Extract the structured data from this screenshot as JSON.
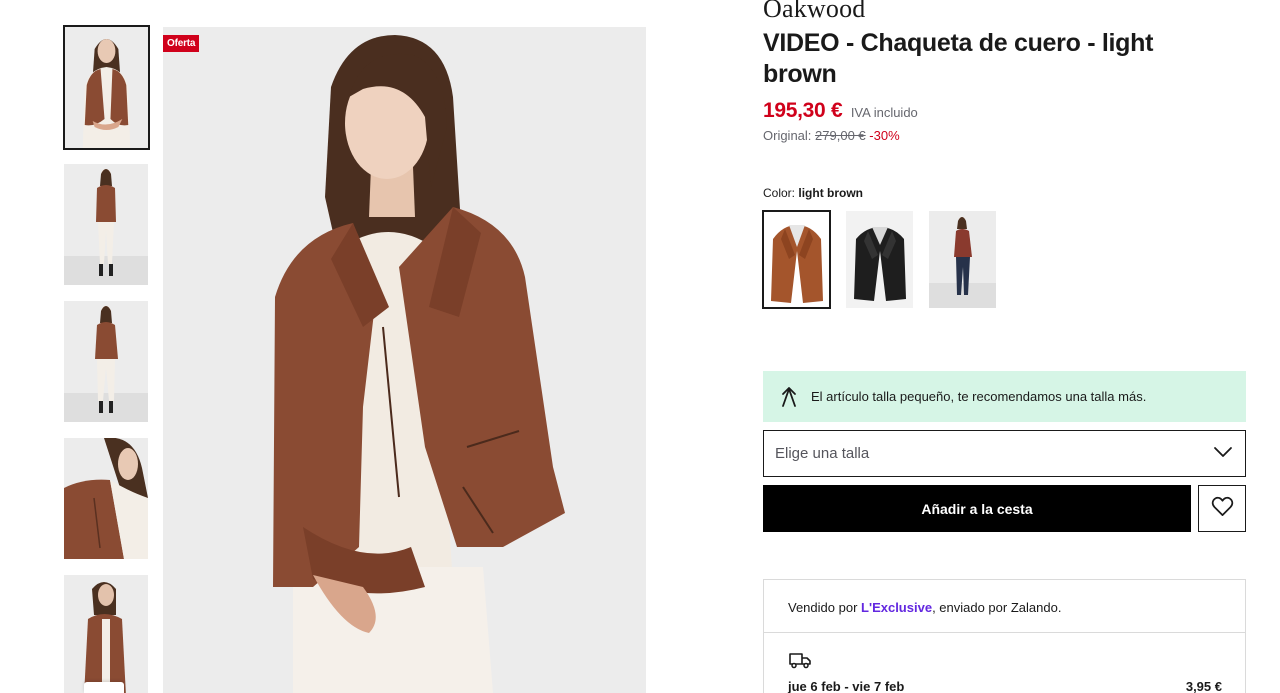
{
  "product": {
    "brand": "Oakwood",
    "title": "VIDEO - Chaqueta de cuero - light brown",
    "price": "195,30 €",
    "vat_note": "IVA incluido",
    "original_label": "Original:",
    "original_price": "279,00 €",
    "discount": "-30%",
    "offer_badge": "Oferta"
  },
  "color": {
    "label": "Color:",
    "selected": "light brown",
    "options_count": 3
  },
  "fit_note": {
    "icon": "size-arrows-icon",
    "text": "El artículo talla pequeño, te recomendamos una talla más."
  },
  "size": {
    "placeholder": "Elige una talla"
  },
  "actions": {
    "add_to_cart": "Añadir a la cesta",
    "wishlist_icon": "heart-icon"
  },
  "seller": {
    "prefix": "Vendido por",
    "name": "L'Exclusive",
    "suffix": ", enviado por Zalando."
  },
  "delivery": {
    "icon": "truck-icon",
    "dates": "jue 6 feb - vie 7 feb",
    "cost": "3,95 €"
  },
  "colors": {
    "sale_red": "#d0011b",
    "fit_green": "#d6f5e6",
    "seller_link": "#6328e0",
    "jacket_brown": "#8a4b33"
  }
}
